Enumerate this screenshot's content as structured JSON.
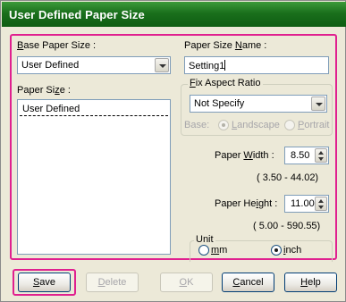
{
  "title": "User Defined Paper Size",
  "base_paper_size": {
    "label_pre": "",
    "label_key": "B",
    "label_post": "ase Paper Size :",
    "value": "User Defined"
  },
  "paper_size_list": {
    "label_pre": "Paper Si",
    "label_key": "z",
    "label_post": "e :",
    "items": [
      "User Defined"
    ]
  },
  "paper_size_name": {
    "label_pre": "Paper Size ",
    "label_key": "N",
    "label_post": "ame :",
    "value": "Setting1"
  },
  "fix_aspect": {
    "label_pre": "",
    "label_key": "F",
    "label_post": "ix Aspect Ratio",
    "value": "Not Specify",
    "base_label": "Base:",
    "landscape_pre": "",
    "landscape_key": "L",
    "landscape_post": "andscape",
    "portrait_pre": "",
    "portrait_key": "P",
    "portrait_post": "ortrait",
    "selected": "landscape"
  },
  "paper_width": {
    "label_pre": "Paper ",
    "label_key": "W",
    "label_post": "idth :",
    "value": "8.50",
    "range": "( 3.50 - 44.02)"
  },
  "paper_height": {
    "label_pre": "Paper He",
    "label_key": "i",
    "label_post": "ght :",
    "value": "11.00",
    "range": "( 5.00 - 590.55)"
  },
  "unit": {
    "label": "Unit",
    "mm_pre": "",
    "mm_key": "m",
    "mm_post": "m",
    "inch_pre": "",
    "inch_key": "i",
    "inch_post": "nch",
    "selected": "inch"
  },
  "buttons": {
    "save": {
      "pre": "",
      "key": "S",
      "post": "ave"
    },
    "delete": {
      "pre": "",
      "key": "D",
      "post": "elete"
    },
    "ok": {
      "pre": "",
      "key": "O",
      "post": "K"
    },
    "cancel": {
      "pre": "",
      "key": "C",
      "post": "ancel"
    },
    "help": {
      "pre": "",
      "key": "H",
      "post": "elp"
    }
  },
  "colors": {
    "highlight": "#e0208f",
    "titlebar": "#1a6f1c",
    "dialog_bg": "#ece9d8"
  }
}
